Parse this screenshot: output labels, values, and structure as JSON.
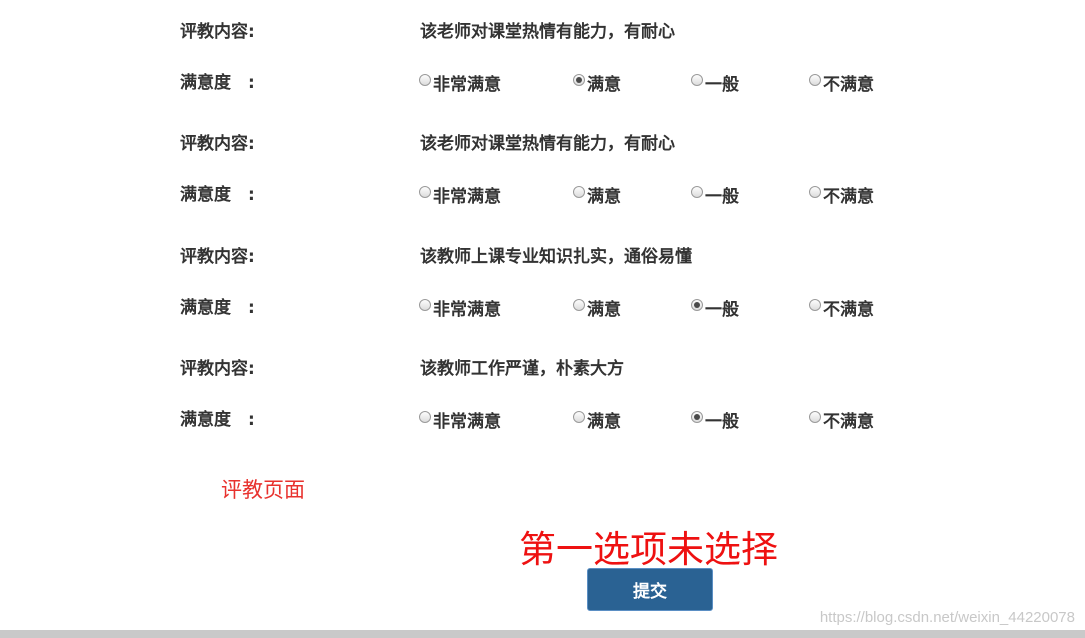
{
  "items": [
    {
      "content_label": "评教内容:",
      "content_text": "该老师对课堂热情有能力，有耐心",
      "satisfaction_label": "满意度　:",
      "options": [
        "非常满意",
        "满意",
        "一般",
        "不满意"
      ],
      "selected": "满意"
    },
    {
      "content_label": "评教内容:",
      "content_text": "该老师对课堂热情有能力，有耐心",
      "satisfaction_label": "满意度　:",
      "options": [
        "非常满意",
        "满意",
        "一般",
        "不满意"
      ],
      "selected": null
    },
    {
      "content_label": "评教内容:",
      "content_text": "该教师上课专业知识扎实，通俗易懂",
      "satisfaction_label": "满意度　:",
      "options": [
        "非常满意",
        "满意",
        "一般",
        "不满意"
      ],
      "selected": "一般"
    },
    {
      "content_label": "评教内容:",
      "content_text": "该教师工作严谨，朴素大方",
      "satisfaction_label": "满意度　:",
      "options": [
        "非常满意",
        "满意",
        "一般",
        "不满意"
      ],
      "selected": "一般"
    }
  ],
  "annotations": {
    "page_caption": "评教页面",
    "warning": "第一选项未选择"
  },
  "submit_label": "提交",
  "watermark": "https://blog.csdn.net/weixin_44220078",
  "colors": {
    "button": "#2a6293",
    "annotation_red": "#ee1111"
  }
}
